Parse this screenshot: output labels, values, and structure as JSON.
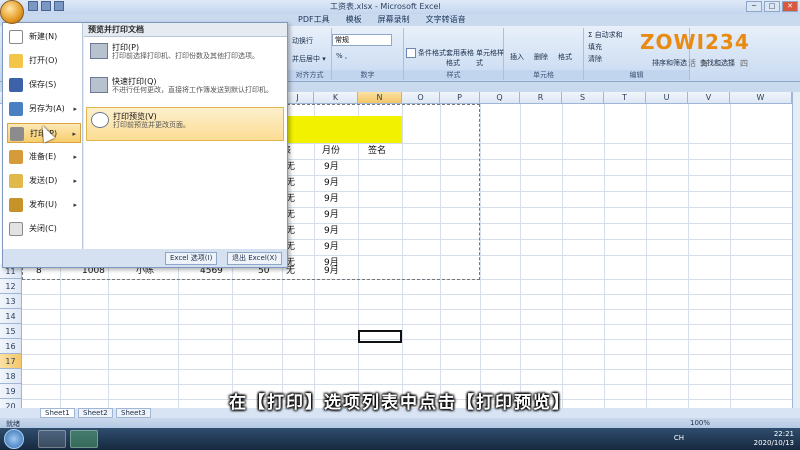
{
  "window": {
    "title": "工资表.xlsx - Microsoft Excel",
    "controls": [
      "─",
      "□",
      "✕"
    ]
  },
  "tabs": [
    "PDF工具",
    "模板",
    "屏幕录制",
    "文字转语音"
  ],
  "ribbon": {
    "wrap_text": "动换行",
    "merge": "并后居中 ▾",
    "number_format": "常规",
    "pct": "% ,",
    "cond_format": "条件格式",
    "table_format": "套用表格格式",
    "cell_style": "单元格样式",
    "insert": "插入",
    "delete": "删除",
    "format": "格式",
    "autosum": "Σ 自动求和",
    "fill": "填充",
    "clear": "清除",
    "sort_filter": "排序和筛选",
    "find_select": "查找和选择",
    "group_number": "数字",
    "group_style": "样式",
    "group_cells": "单元格",
    "group_edit": "编辑",
    "group_align": "对齐方式",
    "logo": "ZOWI234",
    "logo_sub": "活好二三四"
  },
  "office_menu": {
    "items": [
      {
        "label": "新建(N)",
        "icon": "new-doc-icon",
        "color": "#ffffff"
      },
      {
        "label": "打开(O)",
        "icon": "open-folder-icon",
        "color": "#f3c64a"
      },
      {
        "label": "保存(S)",
        "icon": "save-icon",
        "color": "#3d62a8"
      },
      {
        "label": "另存为(A)",
        "icon": "save-as-icon",
        "color": "#4a7fc2"
      },
      {
        "label": "打印(P)",
        "icon": "printer-icon",
        "color": "#8c8c8c"
      },
      {
        "label": "准备(E)",
        "icon": "prepare-icon",
        "color": "#d59b3a"
      },
      {
        "label": "发送(D)",
        "icon": "send-icon",
        "color": "#e0b84b"
      },
      {
        "label": "发布(U)",
        "icon": "publish-icon",
        "color": "#c6922a"
      },
      {
        "label": "关闭(C)",
        "icon": "close-doc-icon",
        "color": "#e2e2e2"
      }
    ],
    "right_title": "预览并打印文档",
    "right_items": [
      {
        "title": "打印(P)",
        "desc": "打印前选择打印机、打印份数及其他打印选项。"
      },
      {
        "title": "快速打印(Q)",
        "desc": "不进行任何更改，直接将工作簿发送到默认打印机。"
      },
      {
        "title": "打印预览(V)",
        "desc": "打印前预览并更改页面。"
      }
    ],
    "excel_options": "Excel 选项(I)",
    "exit_excel": "退出 Excel(X)"
  },
  "sheet": {
    "columns": [
      "J",
      "K",
      "N",
      "O",
      "P",
      "Q",
      "R",
      "S",
      "T",
      "U",
      "V",
      "W"
    ],
    "rows": [
      "11",
      "12",
      "13",
      "14",
      "15",
      "16",
      "17",
      "18",
      "19",
      "20"
    ],
    "header_month": "月份",
    "header_sign": "签名",
    "partial": "无",
    "month_values": [
      "9月",
      "9月",
      "9月",
      "9月",
      "9月",
      "9月",
      "9月",
      "9月"
    ],
    "row11": {
      "num": "8",
      "id": "1008",
      "name": "小陈",
      "salary": "4569",
      "bonus": "50",
      "partial": "无",
      "month": "9月"
    }
  },
  "sheet_tabs": [
    "Sheet1",
    "Sheet2",
    "Sheet3"
  ],
  "status": {
    "left": "就绪",
    "zoom": "100%"
  },
  "taskbar": {
    "lang": "CH",
    "time": "22:21",
    "date": "2020/10/13"
  },
  "caption": "在【打印】选项列表中点击【打印预览】"
}
